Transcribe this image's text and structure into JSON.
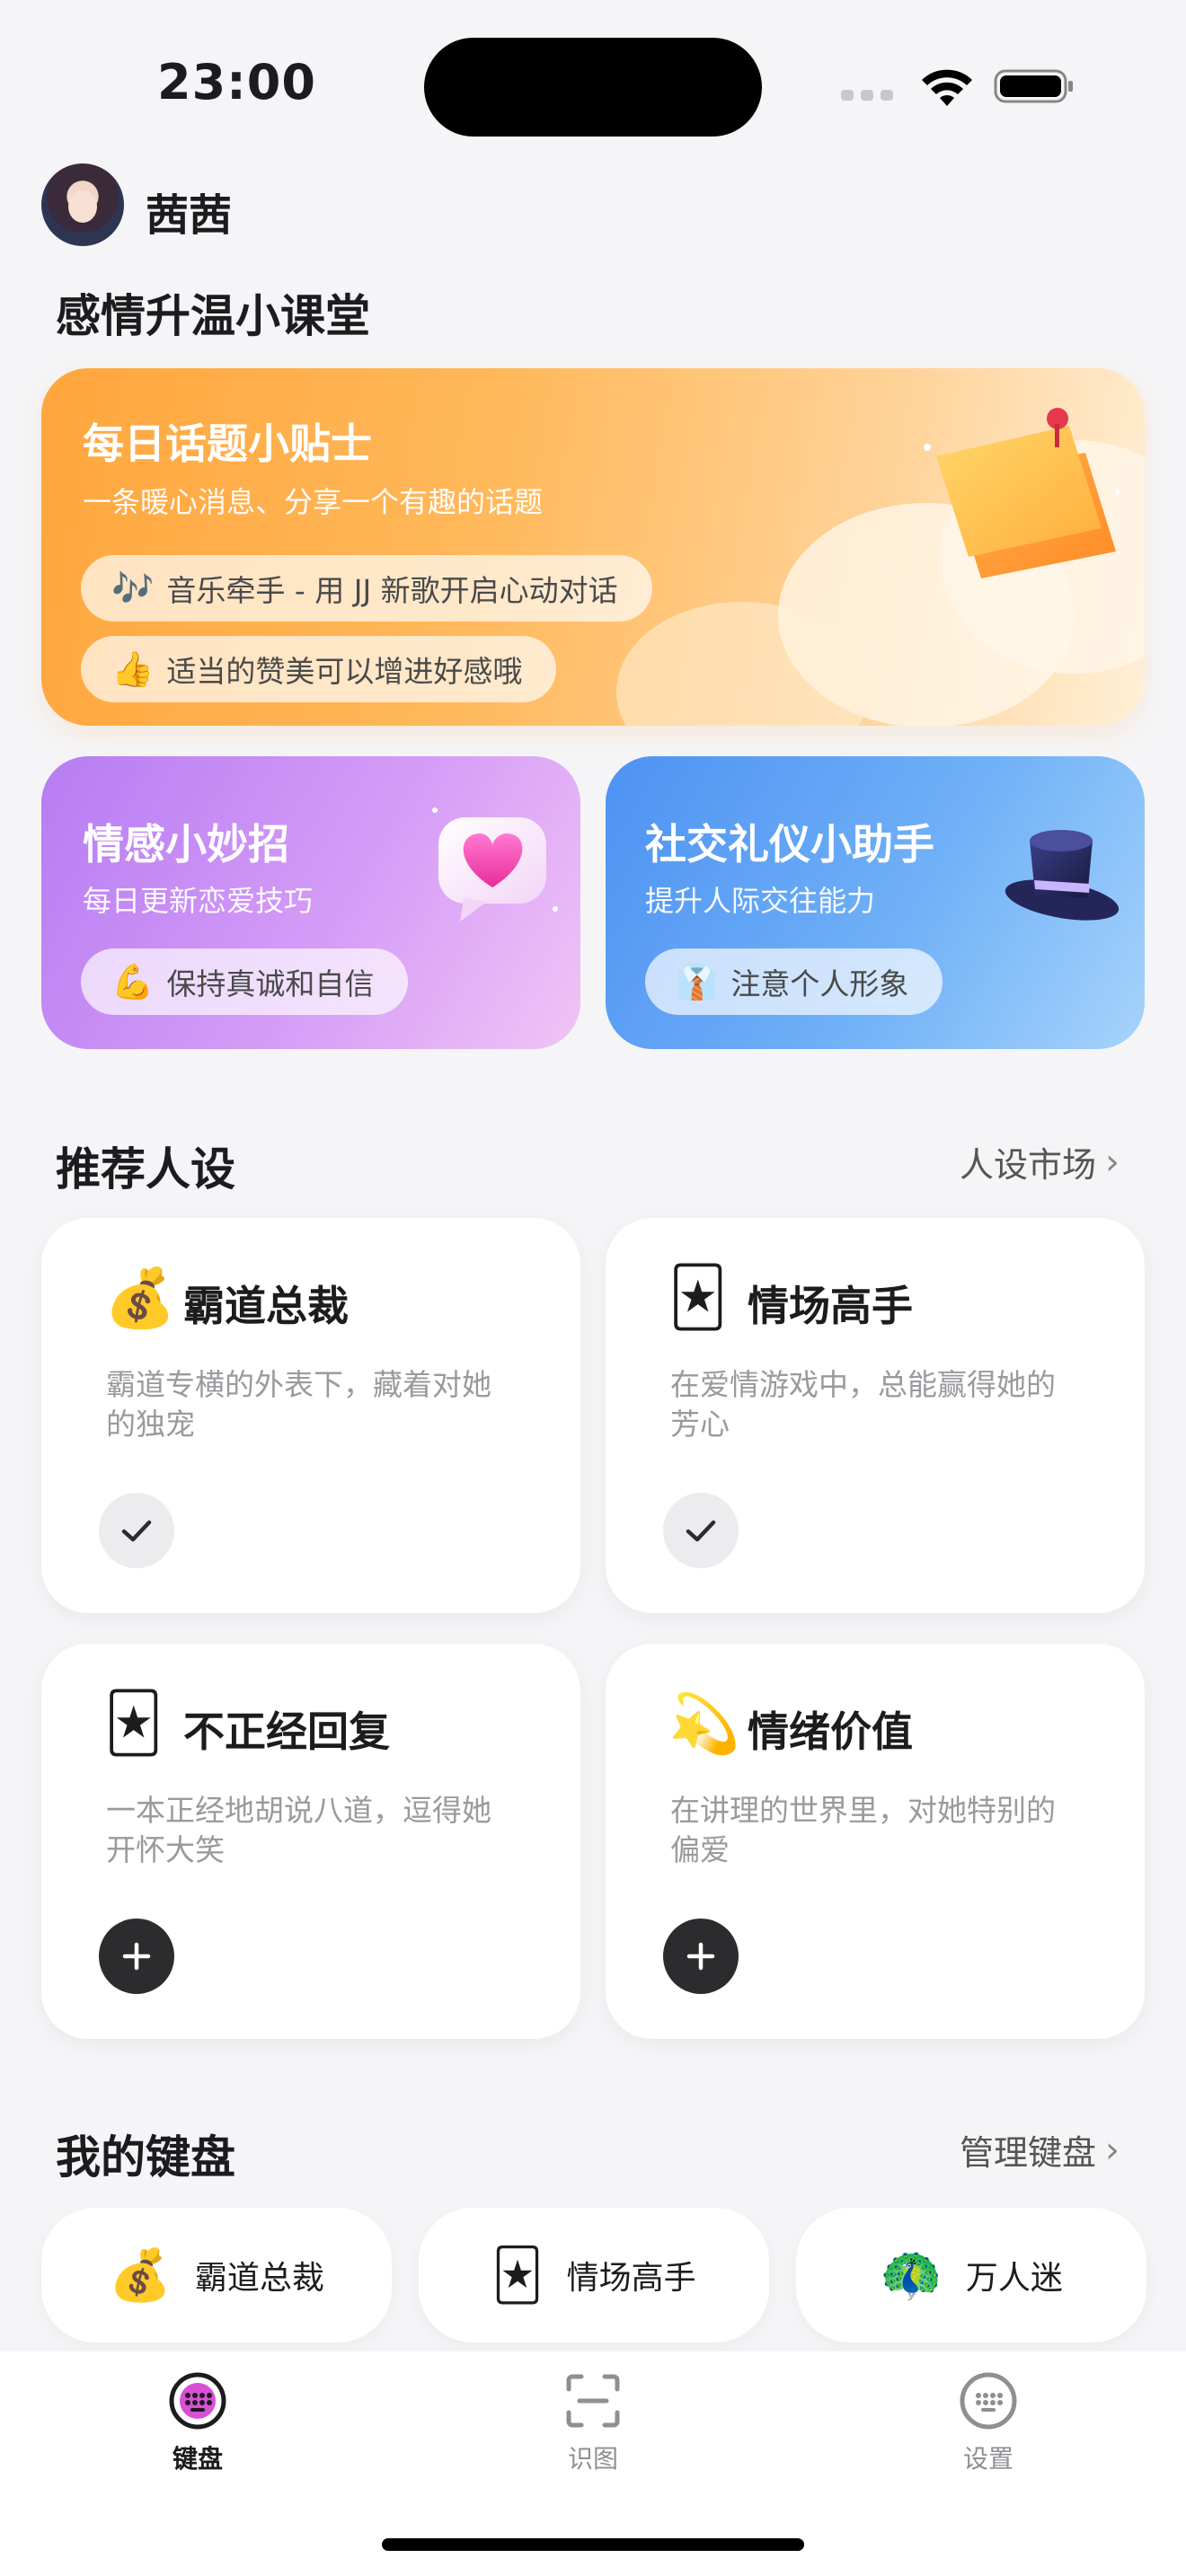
{
  "status_bar": {
    "time": "23:00"
  },
  "header": {
    "username": "茜茜"
  },
  "course": {
    "title": "感情升温小课堂",
    "daily_tip": {
      "title": "每日话题小贴士",
      "subtitle": "一条暖心消息、分享一个有趣的话题",
      "chips": [
        {
          "emoji": "🎶",
          "text": "音乐牵手 - 用 JJ 新歌开启心动对话"
        },
        {
          "emoji": "👍",
          "text": "适当的赞美可以增进好感哦"
        }
      ]
    },
    "love_tips": {
      "title": "情感小妙招",
      "subtitle": "每日更新恋爱技巧",
      "chip": {
        "emoji": "💪",
        "text": "保持真诚和自信"
      }
    },
    "social_tips": {
      "title": "社交礼仪小助手",
      "subtitle": "提升人际交往能力",
      "chip": {
        "emoji": "👔",
        "text": "注意个人形象"
      }
    }
  },
  "personas": {
    "title": "推荐人设",
    "market_link": "人设市场",
    "items": [
      {
        "icon": "💰",
        "icon_name": "money-bag-icon",
        "name": "霸道总裁",
        "desc": "霸道专横的外表下，藏着对她的独宠",
        "state": "added"
      },
      {
        "icon": "🃏",
        "icon_name": "joker-card-icon",
        "name": "情场高手",
        "desc": "在爱情游戏中，总能赢得她的芳心",
        "state": "added"
      },
      {
        "icon": "🃏",
        "icon_name": "joker-card-icon",
        "name": "不正经回复",
        "desc": "一本正经地胡说八道，逗得她开怀大笑",
        "state": "not_added"
      },
      {
        "icon": "💫",
        "icon_name": "halo-star-icon",
        "name": "情绪价值",
        "desc": "在讲理的世界里，对她特别的偏爱",
        "state": "not_added"
      }
    ]
  },
  "keyboards": {
    "title": "我的键盘",
    "manage_link": "管理键盘",
    "items": [
      {
        "icon": "💰",
        "name": "霸道总裁"
      },
      {
        "icon": "🃏",
        "name": "情场高手"
      },
      {
        "icon": "🦚",
        "name": "万人迷"
      }
    ]
  },
  "tabbar": {
    "tabs": [
      {
        "label": "键盘",
        "icon": "keyboard-icon",
        "active": true
      },
      {
        "label": "识图",
        "icon": "scan-icon",
        "active": false
      },
      {
        "label": "设置",
        "icon": "settings-icon",
        "active": false
      }
    ]
  },
  "colors": {
    "tip_gradient": "#ffa63d",
    "love_gradient": "#b77cf2",
    "social_gradient": "#4e92f3",
    "dark_button": "#2c2c2e"
  }
}
